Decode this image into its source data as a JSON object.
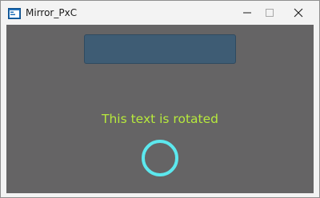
{
  "window": {
    "title": "Mirror_PxC",
    "app_icon": "app-window-icon",
    "controls": {
      "minimize_icon": "minimize-icon",
      "maximize_icon": "maximize-icon",
      "close_icon": "close-icon"
    }
  },
  "content": {
    "rotated_text": "This text is rotated",
    "panel_color": "#3e5c74",
    "text_color": "#b7ea3c",
    "ring_color": "#5ce8ee",
    "background_color": "#656465"
  }
}
